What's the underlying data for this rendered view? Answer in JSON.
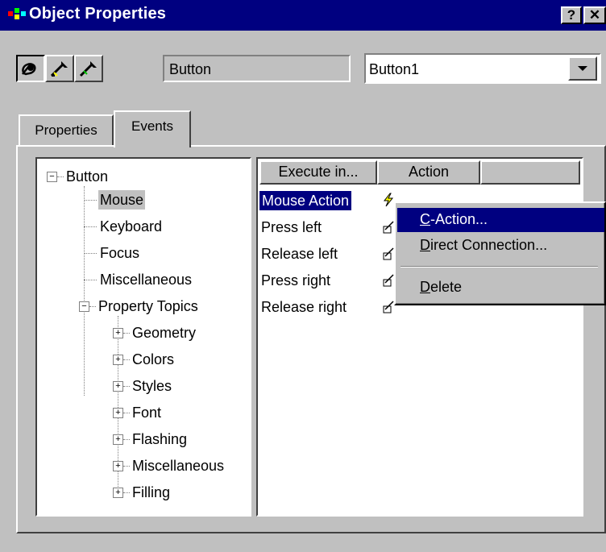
{
  "window": {
    "title": "Object Properties",
    "help_label": "?",
    "close_label": "✕"
  },
  "toolbar": {
    "type_value": "Button",
    "object_combo_value": "Button1",
    "buttons": [
      "pin-icon",
      "pipette-icon",
      "pipette-alt-icon"
    ]
  },
  "tabs": [
    {
      "label": "Properties"
    },
    {
      "label": "Events"
    }
  ],
  "tree": {
    "root": "Button",
    "items": [
      "Mouse",
      "Keyboard",
      "Focus",
      "Miscellaneous"
    ],
    "group": "Property Topics",
    "subitems": [
      "Geometry",
      "Colors",
      "Styles",
      "Font",
      "Flashing",
      "Miscellaneous",
      "Filling"
    ],
    "expand_collapsed": "+",
    "expand_open": "−"
  },
  "events": {
    "columns": [
      "Execute in...",
      "Action"
    ],
    "rows": [
      "Mouse Action",
      "Press left",
      "Release left",
      "Press right",
      "Release right"
    ]
  },
  "context_menu": {
    "items": [
      {
        "label_u": "C",
        "label_rest": "-Action..."
      },
      {
        "label_u": "D",
        "label_rest": "irect Connection..."
      },
      {
        "label_u": "D",
        "label_rest": "elete"
      }
    ]
  },
  "colors": {
    "titlebar": "#000080",
    "selection": "#000080",
    "face": "#c0c0c0"
  }
}
